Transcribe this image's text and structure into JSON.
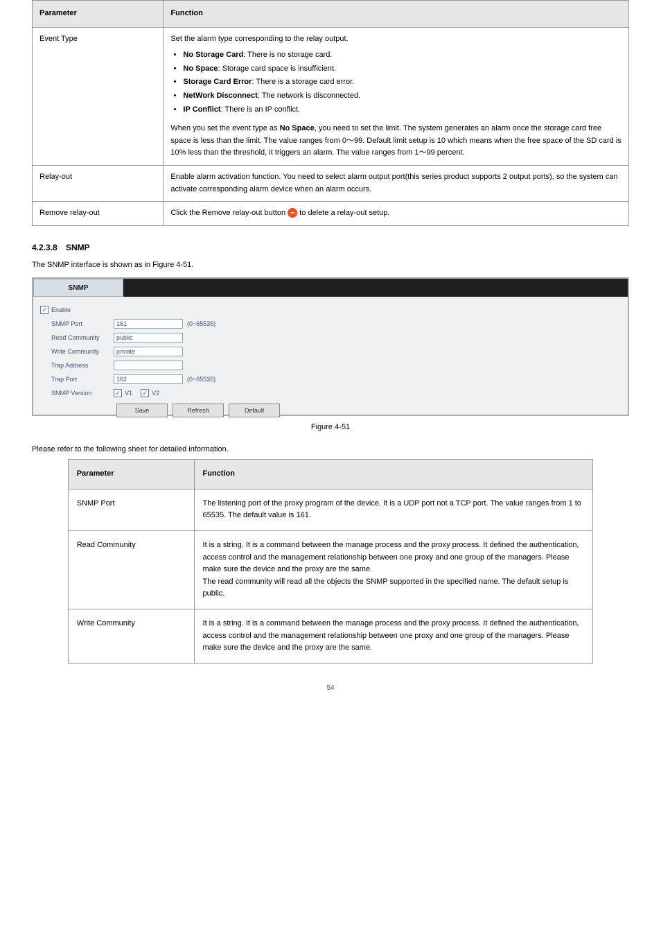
{
  "table1": {
    "header": {
      "param": "Parameter",
      "func": "Function"
    },
    "rows": [
      {
        "param": "Event Type",
        "intro": "Set the alarm type corresponding to the relay output.",
        "bullets": [
          {
            "b": "No Storage Card",
            "rest": ": There is no storage card."
          },
          {
            "b": "No Space",
            "rest": ": Storage card space is insufficient."
          },
          {
            "b": "Storage Card Error",
            "rest": ": There is a storage card error."
          },
          {
            "b": "NetWork Disconnect",
            "rest": ": The network is disconnected."
          },
          {
            "b": "IP Conflict",
            "rest": ": There is an IP conflict."
          }
        ],
        "limit_pre": "When you set the event type as ",
        "limit_b": "No Space",
        "limit_mid": ", you need to set the limit. The system generates an alarm once the storage card free space is less than the limit. The value ranges from 0",
        "limit_mid2": "99. Default limit setup is 10 which means when the free space of the SD card is 10% less than the threshold, it triggers an alarm. The value ranges from 1",
        "limit_tail": "99 percent."
      },
      {
        "param": "Relay-out",
        "func_line1": "Enable alarm activation function. You need to select alarm output port(this series product supports 2 output ports), so the system can activate corresponding alarm device when an alarm occurs."
      },
      {
        "param": "Remove relay-out",
        "func_pre": "Click the Remove relay-out button ",
        "func_post": " to delete a relay-out setup."
      }
    ]
  },
  "section": {
    "num": "4.2.3.8",
    "title": "SNMP",
    "intro": "The SNMP interface is shown as in Figure 4-51."
  },
  "shot": {
    "tab": "SNMP",
    "enable": "Enable",
    "rows": [
      {
        "label": "SNMP Port",
        "value": "161",
        "note": "(0~65535)"
      },
      {
        "label": "Read Community",
        "value": "public",
        "note": ""
      },
      {
        "label": "Write Community",
        "value": "private",
        "note": ""
      },
      {
        "label": "Trap Address",
        "value": "",
        "note": ""
      },
      {
        "label": "Trap Port",
        "value": "162",
        "note": "(0~65535)"
      }
    ],
    "version_label": "SNMP Version",
    "v1": "V1",
    "v2": "V2",
    "buttons": {
      "save": "Save",
      "refresh": "Refresh",
      "default": "Default"
    }
  },
  "figure_caption": "Figure 4-51",
  "table2_intro": "Please refer to the following sheet for detailed information.",
  "table2": {
    "header": {
      "param": "Parameter",
      "func": "Function"
    },
    "rows": [
      {
        "param": "SNMP Port",
        "func": "The listening port of the proxy program of the device. It is a UDP port not a TCP port. The value ranges from 1 to 65535. The default value is 161."
      },
      {
        "param": "Read Community",
        "func": "It is a string. It is a command between the manage process and the proxy process. It defined the authentication, access control and the management relationship between one proxy and one group of the managers. Please make sure the device and the proxy are the same.\nThe read community will read all the objects the SNMP supported in the specified name. The default setup is public."
      },
      {
        "param": "Write Community",
        "func": "It is a string. It is a command between the manage process and the proxy process. It defined the authentication, access control and the management relationship between one proxy and one group of the managers. Please make sure the device and the proxy are the same."
      }
    ]
  },
  "page_number": "54"
}
